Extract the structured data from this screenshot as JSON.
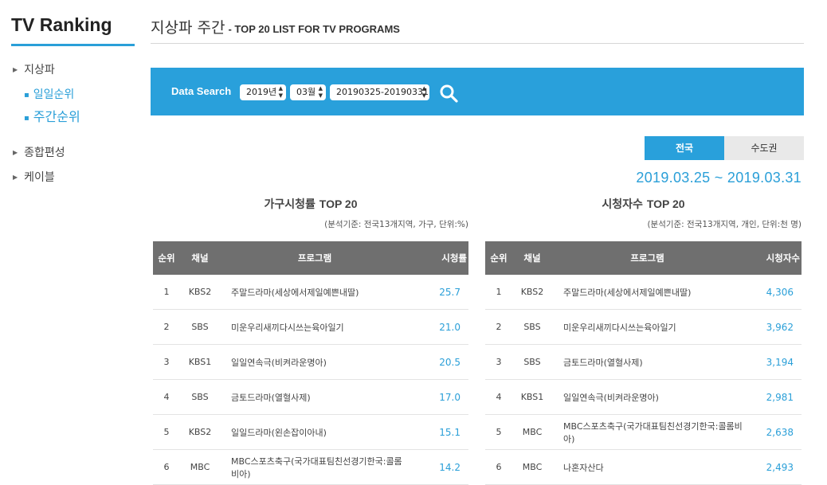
{
  "sidebar": {
    "title": "TV Ranking",
    "items": [
      {
        "label": "지상파"
      },
      {
        "label": "종합편성"
      },
      {
        "label": "케이블"
      }
    ],
    "sub_items": [
      {
        "label": "일일순위"
      },
      {
        "label": "주간순위"
      }
    ],
    "active_sub": "주간순위"
  },
  "header": {
    "title_ko": "지상파 주간",
    "title_en": "- TOP 20 LIST FOR TV PROGRAMS"
  },
  "search": {
    "label": "Data Search",
    "year": "2019년",
    "month": "03월",
    "week": "20190325-20190331",
    "icon": "search-icon"
  },
  "tabs": [
    {
      "label": "전국",
      "active": true
    },
    {
      "label": "수도권",
      "active": false
    }
  ],
  "date_range": "2019.03.25 ~ 2019.03.31",
  "household": {
    "title_ko": "가구시청률",
    "title_en": "TOP 20",
    "note": "(분석기준: 전국13개지역, 가구, 단위:%)",
    "headers": [
      "순위",
      "채널",
      "프로그램",
      "시청률"
    ],
    "rows": [
      {
        "rank": "1",
        "channel": "KBS2",
        "program": "주말드라마(세상에서제일예쁜내딸)",
        "value": "25.7"
      },
      {
        "rank": "2",
        "channel": "SBS",
        "program": "미운우리새끼다시쓰는육아일기",
        "value": "21.0"
      },
      {
        "rank": "3",
        "channel": "KBS1",
        "program": "일일연속극(비켜라운명아)",
        "value": "20.5"
      },
      {
        "rank": "4",
        "channel": "SBS",
        "program": "금토드라마(열혈사제)",
        "value": "17.0"
      },
      {
        "rank": "5",
        "channel": "KBS2",
        "program": "일일드라마(왼손잡이아내)",
        "value": "15.1"
      },
      {
        "rank": "6",
        "channel": "MBC",
        "program": "MBC스포츠축구(국가대표팀친선경기한국:콜롬비아)",
        "value": "14.2"
      }
    ]
  },
  "viewers": {
    "title_ko": "시청자수",
    "title_en": "TOP 20",
    "note": "(분석기준: 전국13개지역, 개인, 단위:천 명)",
    "headers": [
      "순위",
      "채널",
      "프로그램",
      "시청자수"
    ],
    "rows": [
      {
        "rank": "1",
        "channel": "KBS2",
        "program": "주말드라마(세상에서제일예쁜내딸)",
        "value": "4,306"
      },
      {
        "rank": "2",
        "channel": "SBS",
        "program": "미운우리새끼다시쓰는육아일기",
        "value": "3,962"
      },
      {
        "rank": "3",
        "channel": "SBS",
        "program": "금토드라마(열혈사제)",
        "value": "3,194"
      },
      {
        "rank": "4",
        "channel": "KBS1",
        "program": "일일연속극(비켜라운명아)",
        "value": "2,981"
      },
      {
        "rank": "5",
        "channel": "MBC",
        "program": "MBC스포츠축구(국가대표팀친선경기한국:콜롬비아)",
        "value": "2,638"
      },
      {
        "rank": "6",
        "channel": "MBC",
        "program": "나혼자산다",
        "value": "2,493"
      }
    ]
  }
}
